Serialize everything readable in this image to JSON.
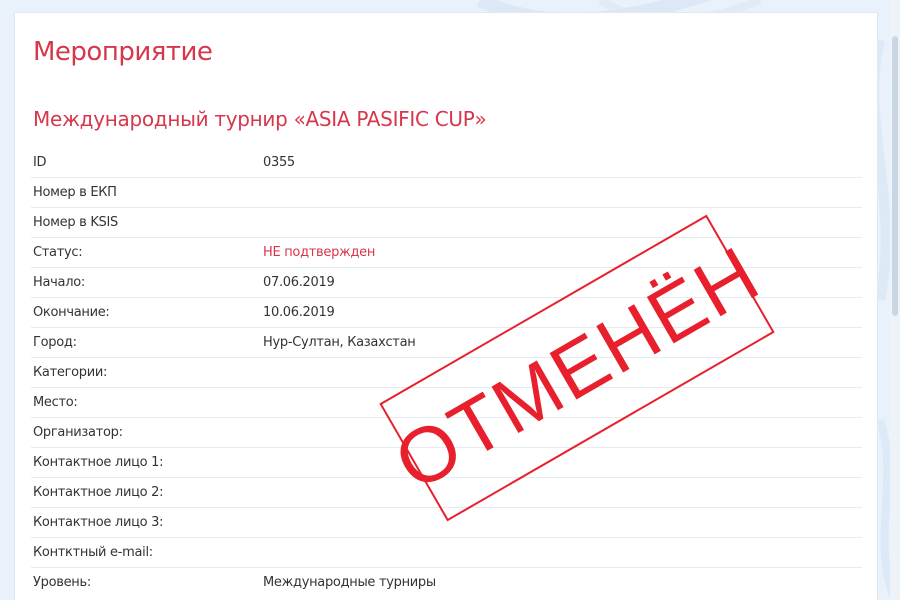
{
  "page_title": "Мероприятие",
  "event_title": "Международный турнир «ASIA PASIFIC CUP»",
  "details": [
    {
      "label": "ID",
      "value": "0355"
    },
    {
      "label": "Номер в ЕКП",
      "value": ""
    },
    {
      "label": "Номер в KSIS",
      "value": ""
    },
    {
      "label": "Статус:",
      "value": "НЕ подтвержден"
    },
    {
      "label": "Начало:",
      "value": "07.06.2019"
    },
    {
      "label": "Окончание:",
      "value": "10.06.2019"
    },
    {
      "label": "Город:",
      "value": "Нур-Султан, Казахстан"
    },
    {
      "label": "Категории:",
      "value": ""
    },
    {
      "label": "Место:",
      "value": ""
    },
    {
      "label": "Организатор:",
      "value": ""
    },
    {
      "label": "Контактное лицо 1:",
      "value": ""
    },
    {
      "label": "Контактное лицо 2:",
      "value": ""
    },
    {
      "label": "Контактное лицо 3:",
      "value": ""
    },
    {
      "label": "Контктный e-mail:",
      "value": ""
    },
    {
      "label": "Уровень:",
      "value": "Международные турниры"
    }
  ],
  "stamp": {
    "text": "ОТМЕНЁН",
    "color": "#e8202e"
  },
  "colors": {
    "accent": "#d6374b",
    "background": "#e9f1fa"
  }
}
